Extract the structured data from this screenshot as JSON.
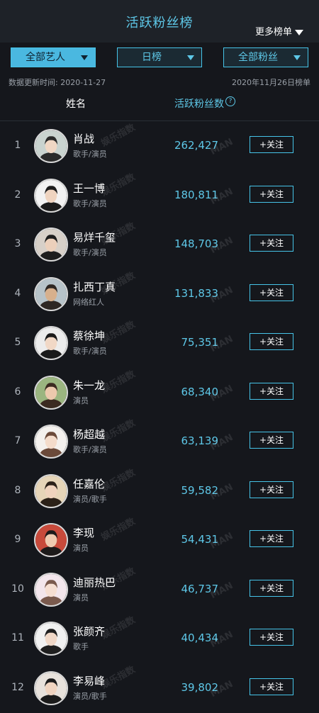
{
  "header": {
    "title": "活跃粉丝榜",
    "more_label": "更多榜单"
  },
  "filters": [
    {
      "label": "全部艺人",
      "active": true
    },
    {
      "label": "日榜",
      "active": false
    },
    {
      "label": "全部粉丝",
      "active": false
    }
  ],
  "meta": {
    "updated": "数据更新时间: 2020-11-27",
    "board_date": "2020年11月26日榜单"
  },
  "columns": {
    "name": "姓名",
    "fans": "活跃粉丝数"
  },
  "rows": [
    {
      "rank": "1",
      "name": "肖战",
      "role": "歌手/演员",
      "count": "262,427",
      "follow": "+关注"
    },
    {
      "rank": "2",
      "name": "王一博",
      "role": "歌手/演员",
      "count": "180,811",
      "follow": "+关注"
    },
    {
      "rank": "3",
      "name": "易烊千玺",
      "role": "歌手/演员",
      "count": "148,703",
      "follow": "+关注"
    },
    {
      "rank": "4",
      "name": "扎西丁真",
      "role": "网络红人",
      "count": "131,833",
      "follow": "+关注"
    },
    {
      "rank": "5",
      "name": "蔡徐坤",
      "role": "歌手/演员",
      "count": "75,351",
      "follow": "+关注"
    },
    {
      "rank": "6",
      "name": "朱一龙",
      "role": "演员",
      "count": "68,340",
      "follow": "+关注"
    },
    {
      "rank": "7",
      "name": "杨超越",
      "role": "歌手/演员",
      "count": "63,139",
      "follow": "+关注"
    },
    {
      "rank": "8",
      "name": "任嘉伦",
      "role": "演员/歌手",
      "count": "59,582",
      "follow": "+关注"
    },
    {
      "rank": "9",
      "name": "李现",
      "role": "演员",
      "count": "54,431",
      "follow": "+关注"
    },
    {
      "rank": "10",
      "name": "迪丽热巴",
      "role": "演员",
      "count": "46,737",
      "follow": "+关注"
    },
    {
      "rank": "11",
      "name": "张颜齐",
      "role": "歌手",
      "count": "40,434",
      "follow": "+关注"
    },
    {
      "rank": "12",
      "name": "李易峰",
      "role": "演员/歌手",
      "count": "39,802",
      "follow": "+关注"
    }
  ],
  "watermark": {
    "brand": "MAN",
    "text": "娱乐指数"
  }
}
